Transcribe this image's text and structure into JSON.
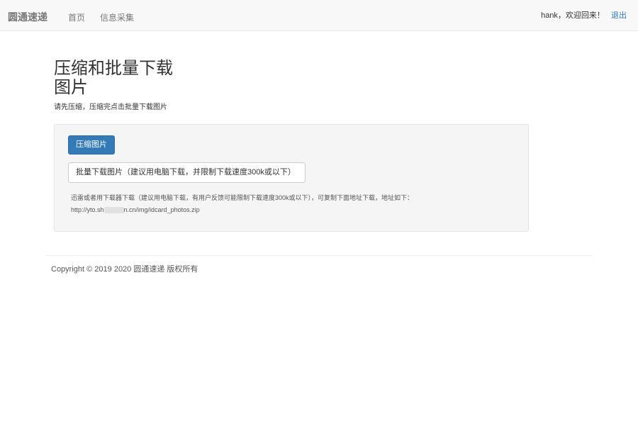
{
  "navbar": {
    "brand": "圆通速递",
    "links": [
      {
        "label": "首页"
      },
      {
        "label": "信息采集"
      }
    ],
    "greeting": "hank，欢迎回来！",
    "logout_label": "退出"
  },
  "main": {
    "title": "压缩和批量下载图片",
    "instructions": "请先压缩，压缩完点击批量下载图片"
  },
  "panel": {
    "compress_label": "压缩图片",
    "download_label": "批量下载图片（建议用电脑下载，并限制下载速度300k或以下）",
    "note_line1": "迅雷或者用下载器下载（建议用电脑下载，有用户反馈可能限制下载速度300k或以下），可复制下面地址下载，地址如下：",
    "url_prefix": "http://yto.sh",
    "url_suffix": "n.cn/img/idcard_photos.zip"
  },
  "footer": {
    "copyright": "Copyright © 2019 2020 圆通速递 版权所有"
  }
}
